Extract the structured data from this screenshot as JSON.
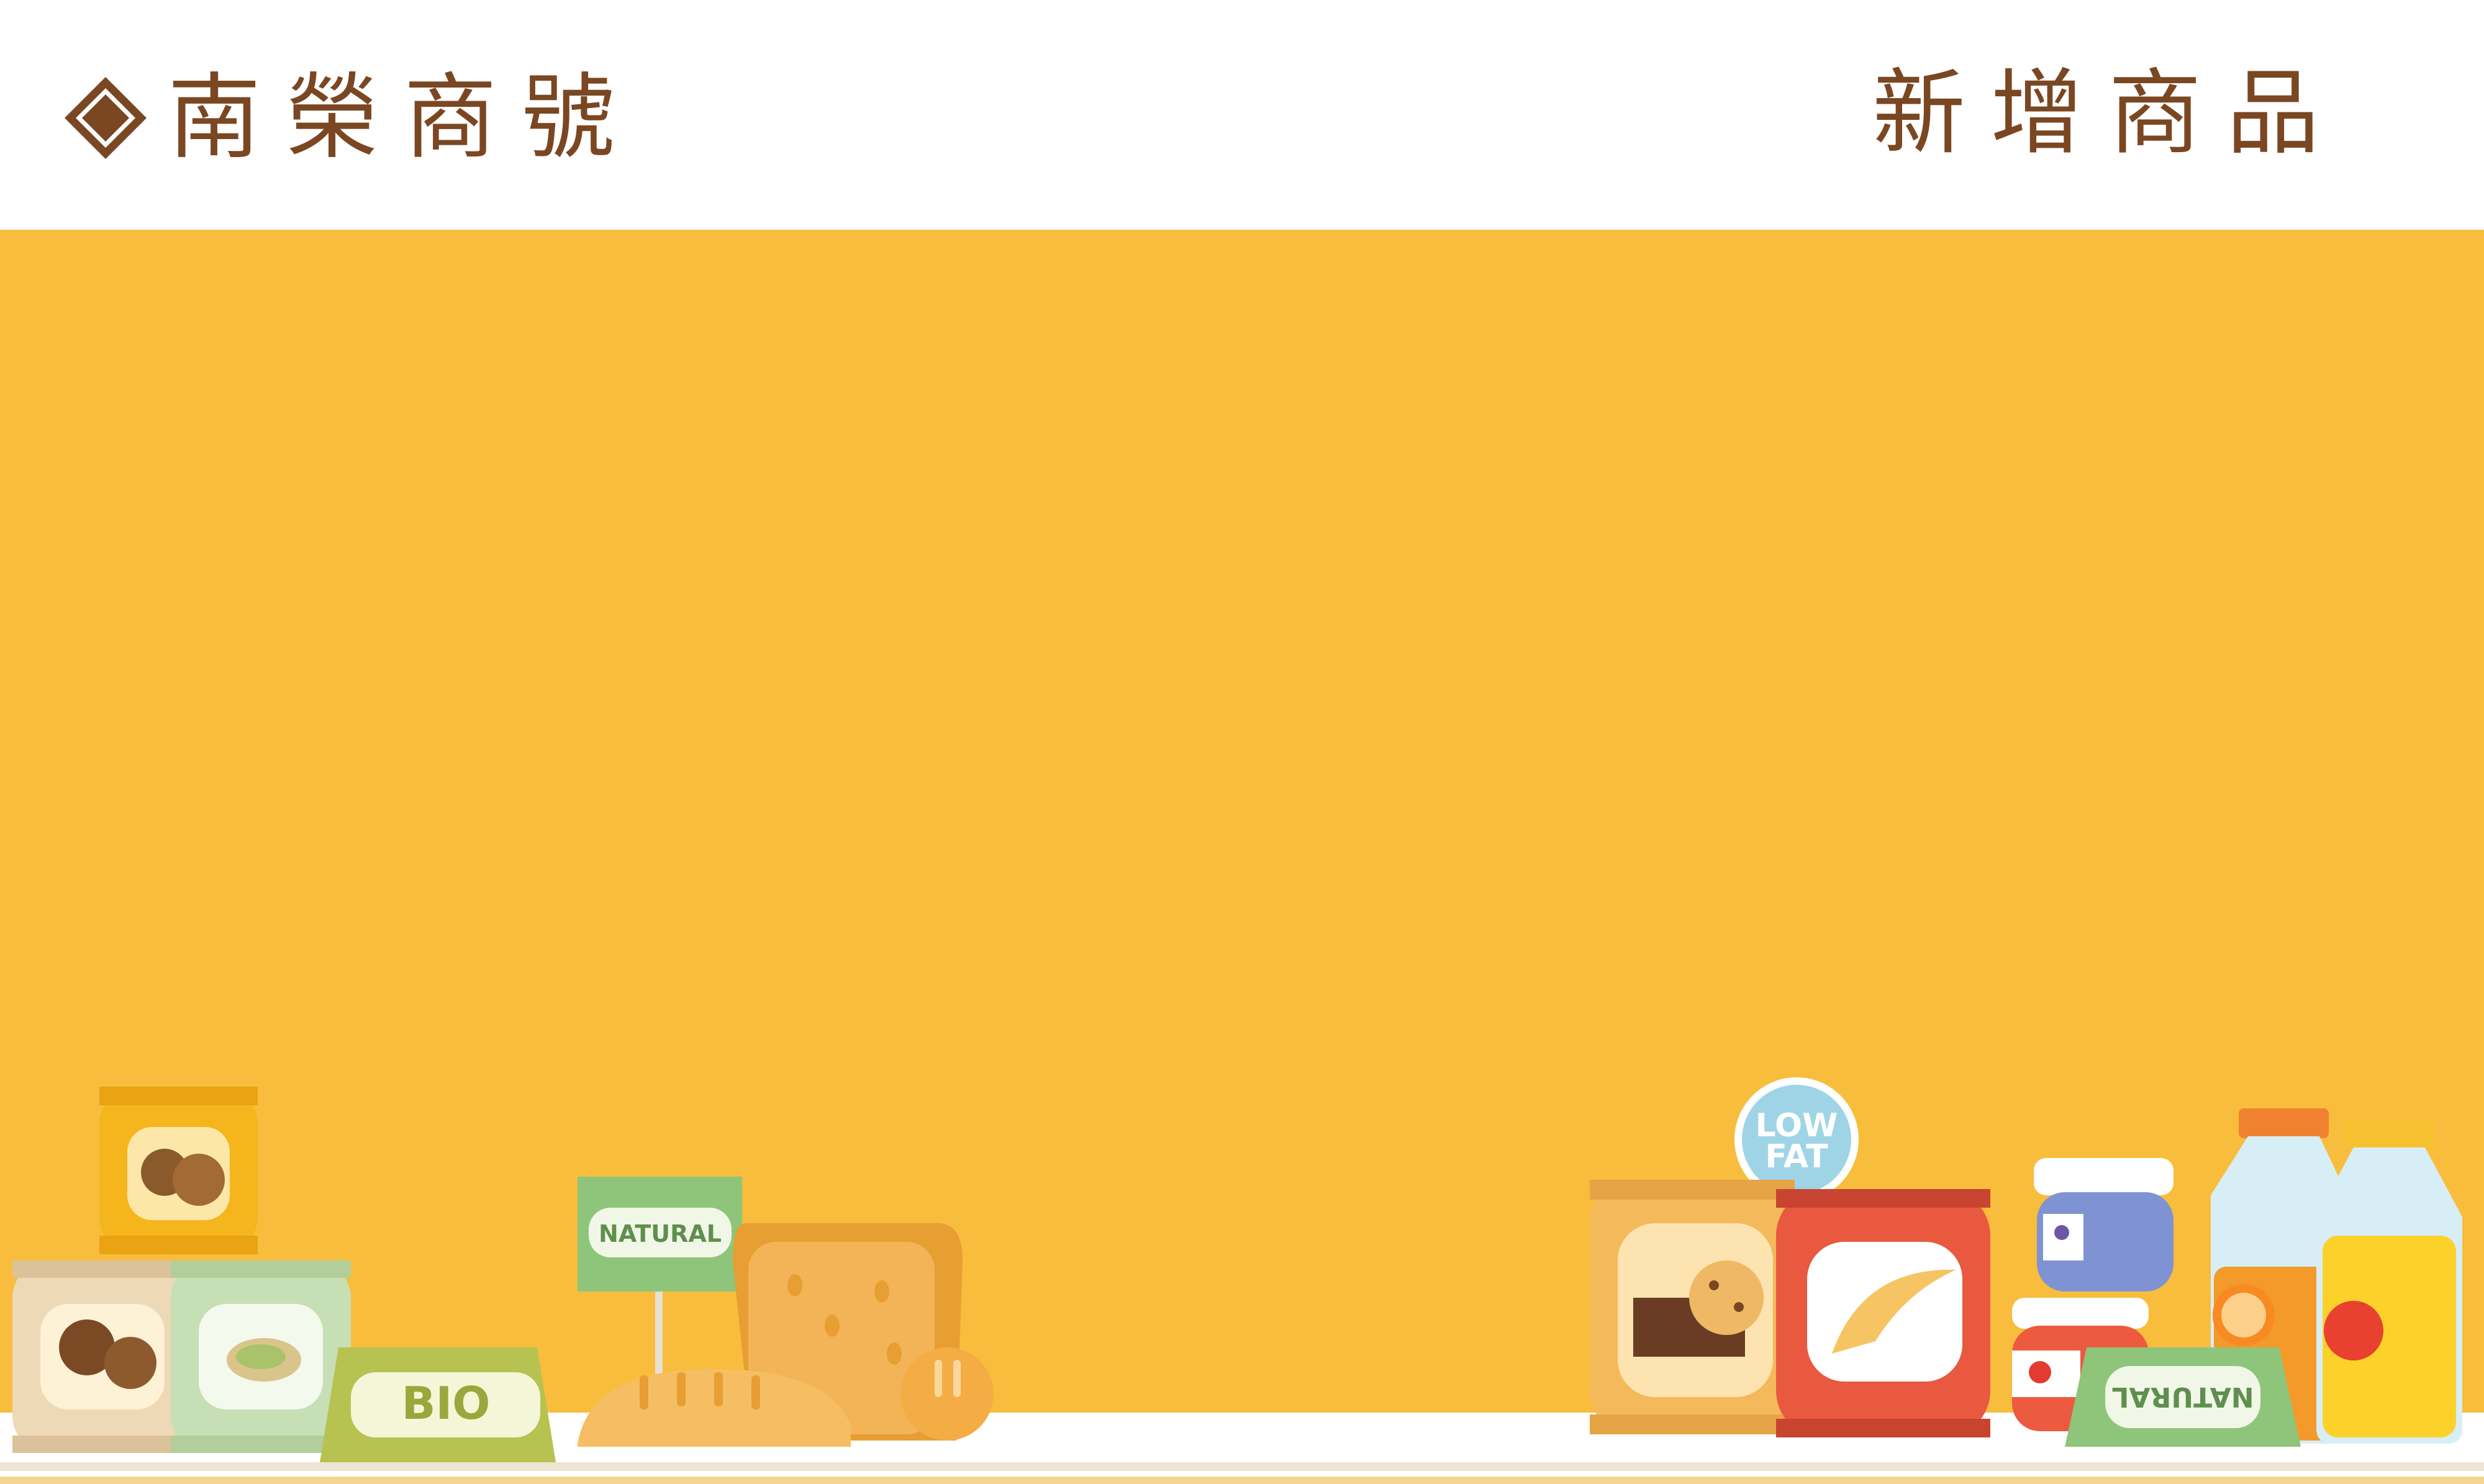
{
  "header": {
    "brand_name": "南榮商號",
    "page_title": "新增商品",
    "logo_icon": "diamond-logo-icon"
  },
  "labels": {
    "bio": "BIO",
    "natural_sign": "NATURAL",
    "low": "LOW",
    "fat": "FAT",
    "natural_tent": "NATURAL"
  },
  "colors": {
    "brand_brown": "#7a4722",
    "main_background": "#f8bd3c",
    "shelf": "#ffffff"
  }
}
